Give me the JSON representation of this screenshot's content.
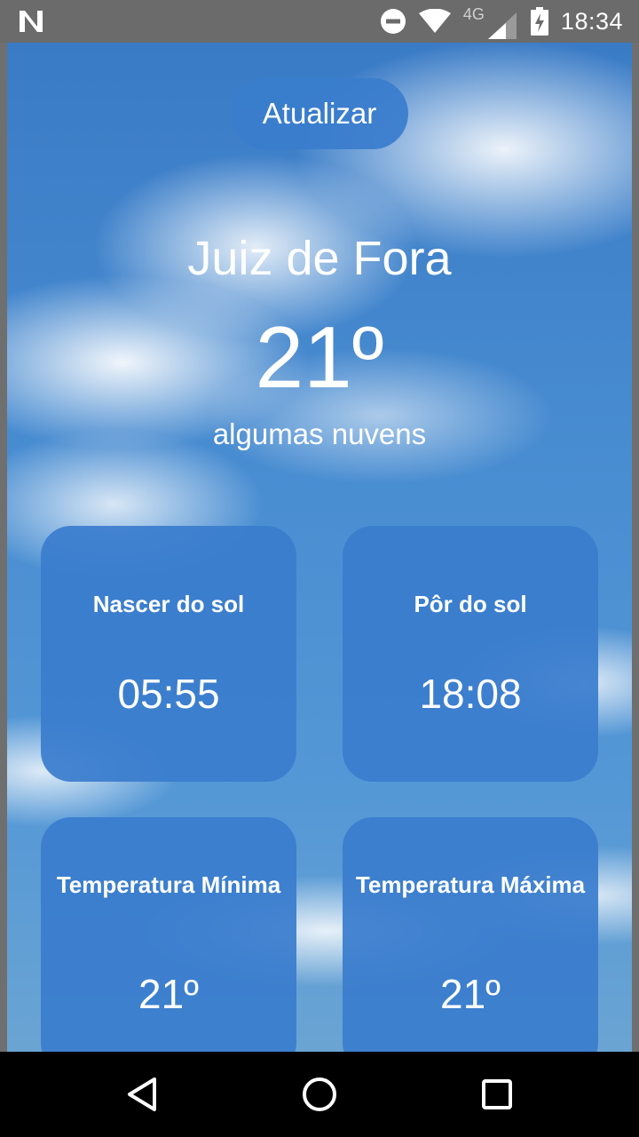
{
  "status_bar": {
    "network_label": "4G",
    "time": "18:34",
    "icons": [
      "n-logo-icon",
      "do-not-disturb-icon",
      "wifi-icon",
      "signal-icon",
      "battery-charging-icon"
    ]
  },
  "app": {
    "refresh_label": "Atualizar",
    "city": "Juiz de Fora",
    "temperature": "21º",
    "condition": "algumas nuvens",
    "cards": {
      "sunrise": {
        "title": "Nascer do sol",
        "value": "05:55"
      },
      "sunset": {
        "title": "Pôr do sol",
        "value": "18:08"
      },
      "temp_min": {
        "title": "Temperatura Mínima",
        "value": "21º"
      },
      "temp_max": {
        "title": "Temperatura Máxima",
        "value": "21º"
      }
    },
    "colors": {
      "card": "#3a7dcd",
      "sky": "#4a8ed2"
    }
  },
  "nav_bar": {
    "icons": [
      "back-icon",
      "home-icon",
      "recents-icon"
    ]
  }
}
